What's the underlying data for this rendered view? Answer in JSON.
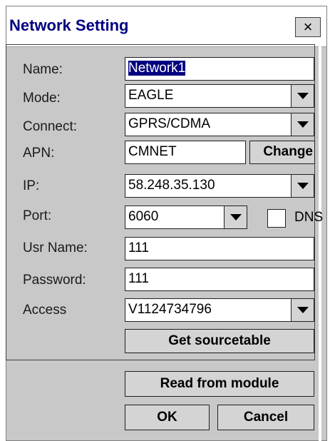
{
  "window": {
    "title": "Network Setting",
    "close_label": "×"
  },
  "form": {
    "name_label": "Name:",
    "name_value": "Network1",
    "mode_label": "Mode:",
    "mode_value": "EAGLE",
    "connect_label": "Connect:",
    "connect_value": "GPRS/CDMA",
    "apn_label": "APN:",
    "apn_value": "CMNET",
    "change_button": "Change",
    "ip_label": "IP:",
    "ip_value": "58.248.35.130",
    "port_label": "Port:",
    "port_value": "6060",
    "dns_label": "DNS",
    "dns_checked": false,
    "usr_label": "Usr Name:",
    "usr_value": "111",
    "password_label": "Password:",
    "password_value": "111",
    "access_label": "Access",
    "access_value": "V1124734796",
    "get_sourcetable_button": "Get sourcetable"
  },
  "footer": {
    "read_button": "Read from module",
    "ok_button": "OK",
    "cancel_button": "Cancel"
  }
}
